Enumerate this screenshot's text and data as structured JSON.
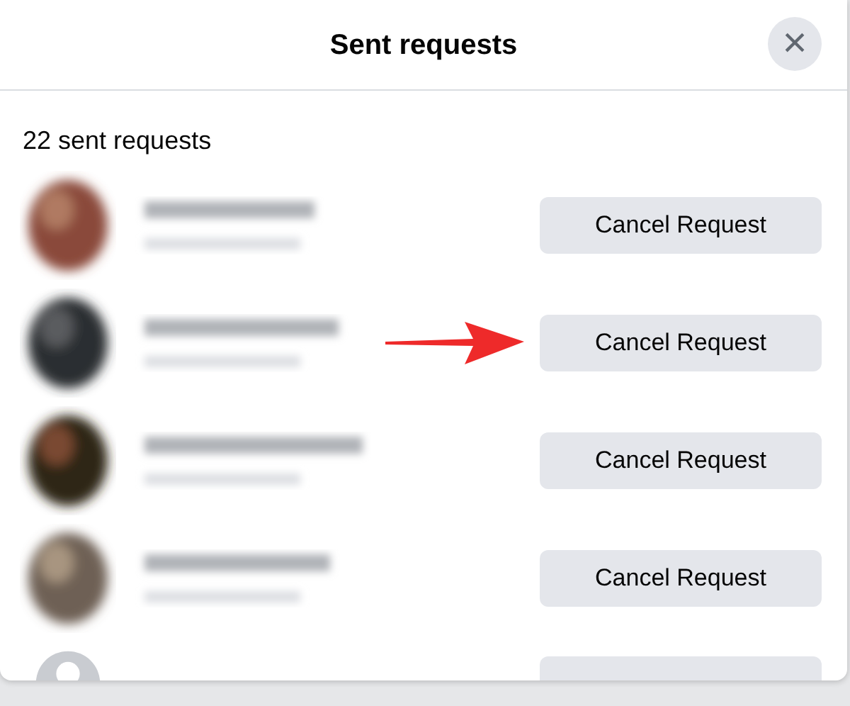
{
  "dialog": {
    "title": "Sent requests",
    "close": "×"
  },
  "count_label": "22 sent requests",
  "requests": [
    {
      "kind": "blurred",
      "button": "Cancel Request",
      "arrow": false
    },
    {
      "kind": "blurred",
      "button": "Cancel Request",
      "arrow": true
    },
    {
      "kind": "blurred",
      "button": "Cancel Request",
      "arrow": false
    },
    {
      "kind": "blurred",
      "button": "Cancel Request",
      "arrow": false
    },
    {
      "kind": "default",
      "arrow": false
    }
  ]
}
